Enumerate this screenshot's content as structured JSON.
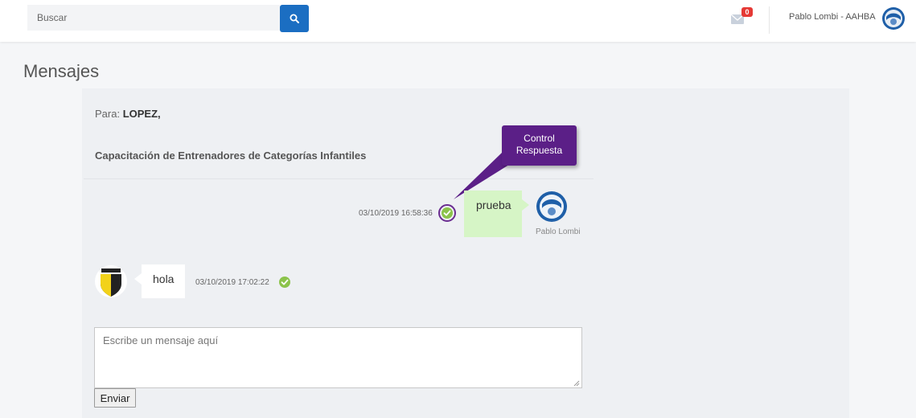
{
  "header": {
    "search": {
      "placeholder": "Buscar",
      "button_icon": "search-icon"
    },
    "mail": {
      "icon": "mail-icon",
      "badge": "0"
    },
    "user": {
      "name": "Pablo Lombi - AAHBA",
      "avatar_icon": "club-logo-icon"
    }
  },
  "page": {
    "title": "Mensajes"
  },
  "conversation": {
    "to_label": "Para:",
    "to_value": "LOPEZ,",
    "subject": "Capacitación de Entrenadores de Categorías Infantiles",
    "messages": [
      {
        "direction": "sent",
        "text": "prueba",
        "timestamp": "03/10/2019 16:58:36",
        "sender": "Pablo Lombi",
        "status_icon": "check-circle-icon"
      },
      {
        "direction": "received",
        "text": "hola",
        "timestamp": "03/10/2019 17:02:22",
        "status_icon": "check-circle-icon"
      }
    ]
  },
  "annotation": {
    "line1": "Control",
    "line2": "Respuesta"
  },
  "composer": {
    "placeholder": "Escribe un mensaje aquí",
    "send_label": "Enviar"
  },
  "colors": {
    "accent": "#1b6ec2",
    "sent_bubble": "#d6f5c6",
    "callout": "#5b1f87",
    "check": "#8bc34a",
    "badge": "#e53935"
  }
}
